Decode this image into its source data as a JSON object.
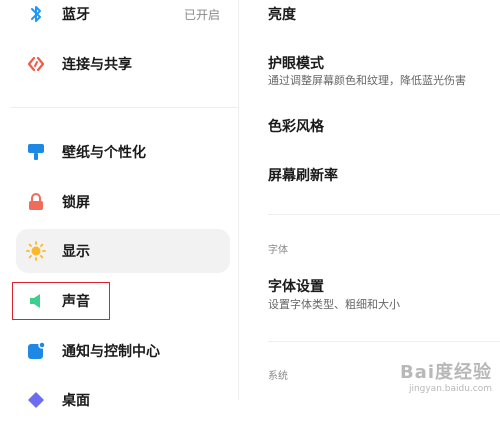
{
  "sidebar": {
    "items": [
      {
        "label": "蓝牙",
        "status": "已开启",
        "icon": "bluetooth-icon",
        "color": "#2196f3"
      },
      {
        "label": "连接与共享",
        "icon": "share-icon",
        "color": "#f05b48"
      },
      {
        "label": "壁纸与个性化",
        "icon": "wallpaper-icon",
        "color": "#1e88e5"
      },
      {
        "label": "锁屏",
        "icon": "lock-icon",
        "color": "#f06b5a"
      },
      {
        "label": "显示",
        "icon": "sun-icon",
        "color": "#fbb92a"
      },
      {
        "label": "声音",
        "icon": "speaker-icon",
        "color": "#3ccf8e"
      },
      {
        "label": "通知与控制中心",
        "icon": "notification-icon",
        "color": "#1e88e5"
      },
      {
        "label": "桌面",
        "icon": "desktop-icon",
        "color": "#6c6cf0"
      }
    ]
  },
  "main": {
    "brightness": "亮度",
    "eye_care": {
      "title": "护眼模式",
      "subtitle": "通过调整屏幕颜色和纹理，降低蓝光伤害"
    },
    "color_style": "色彩风格",
    "refresh_rate": "屏幕刷新率",
    "font_section": "字体",
    "font_settings": {
      "title": "字体设置",
      "subtitle": "设置字体类型、粗细和大小"
    },
    "system_section": "系统"
  },
  "watermark": {
    "main": "Bai度经验",
    "url": "jingyan.baidu.com"
  }
}
